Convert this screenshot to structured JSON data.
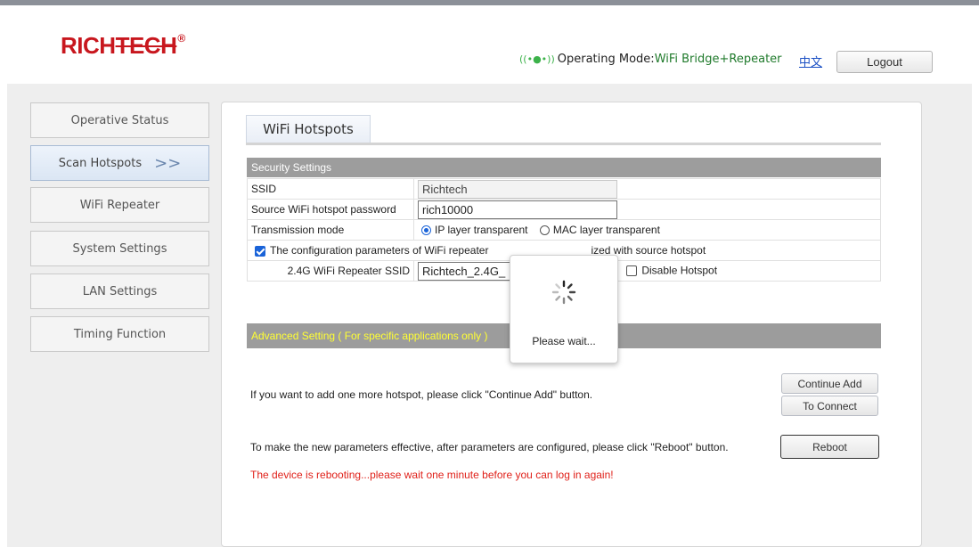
{
  "header": {
    "logo_main": "RICH",
    "logo_tech": "TECH",
    "logo_reg": "®",
    "operating_label": "Operating Mode:",
    "operating_value": "WiFi Bridge+Repeater",
    "language_link": "中文",
    "logout_label": "Logout",
    "signal_icon": "wifi-signal-icon"
  },
  "sidebar": {
    "items": [
      {
        "label": "Operative Status",
        "active": false
      },
      {
        "label": "Scan Hotspots",
        "active": true
      },
      {
        "label": "WiFi Repeater",
        "active": false
      },
      {
        "label": "System Settings",
        "active": false
      },
      {
        "label": "LAN Settings",
        "active": false
      },
      {
        "label": "Timing Function",
        "active": false
      }
    ],
    "active_arrow": ">>"
  },
  "main": {
    "tab_title": "WiFi Hotspots",
    "security": {
      "header": "Security Settings",
      "ssid_label": "SSID",
      "ssid_value": "Richtech",
      "password_label": "Source WiFi hotspot password",
      "password_value": "rich10000",
      "mode_label": "Transmission mode",
      "mode_ip": "IP layer transparent",
      "mode_mac": "MAC layer transparent",
      "mode_selected": "IP layer transparent",
      "sync_text_a": "The configuration parameters of WiFi repeater",
      "sync_text_b": "ized with source hotspot",
      "repeater_ssid_label": "2.4G WiFi Repeater SSID",
      "repeater_ssid_value": "Richtech_2.4G_",
      "disable_hotspot_label": "Disable Hotspot"
    },
    "advanced_header": "Advanced Setting ( For specific applications only )",
    "continue_text": "If you want to add one more hotspot, please click \"Continue Add\" button.",
    "continue_add_label": "Continue Add",
    "to_connect_label": "To Connect",
    "reboot_text": "To make the new parameters effective, after parameters are configured, please click \"Reboot\" button.",
    "reboot_label": "Reboot",
    "rebooting_message": "The device is rebooting...please wait one minute before you can log in again!"
  },
  "loading": {
    "message": "Please wait...",
    "icon": "spinner-icon"
  },
  "colors": {
    "brand_red": "#c8171e",
    "section_header": "#9d9d9d",
    "advanced_header_text": "#ffff33",
    "error_red": "#e0221b",
    "link_blue": "#1a4fc4"
  }
}
